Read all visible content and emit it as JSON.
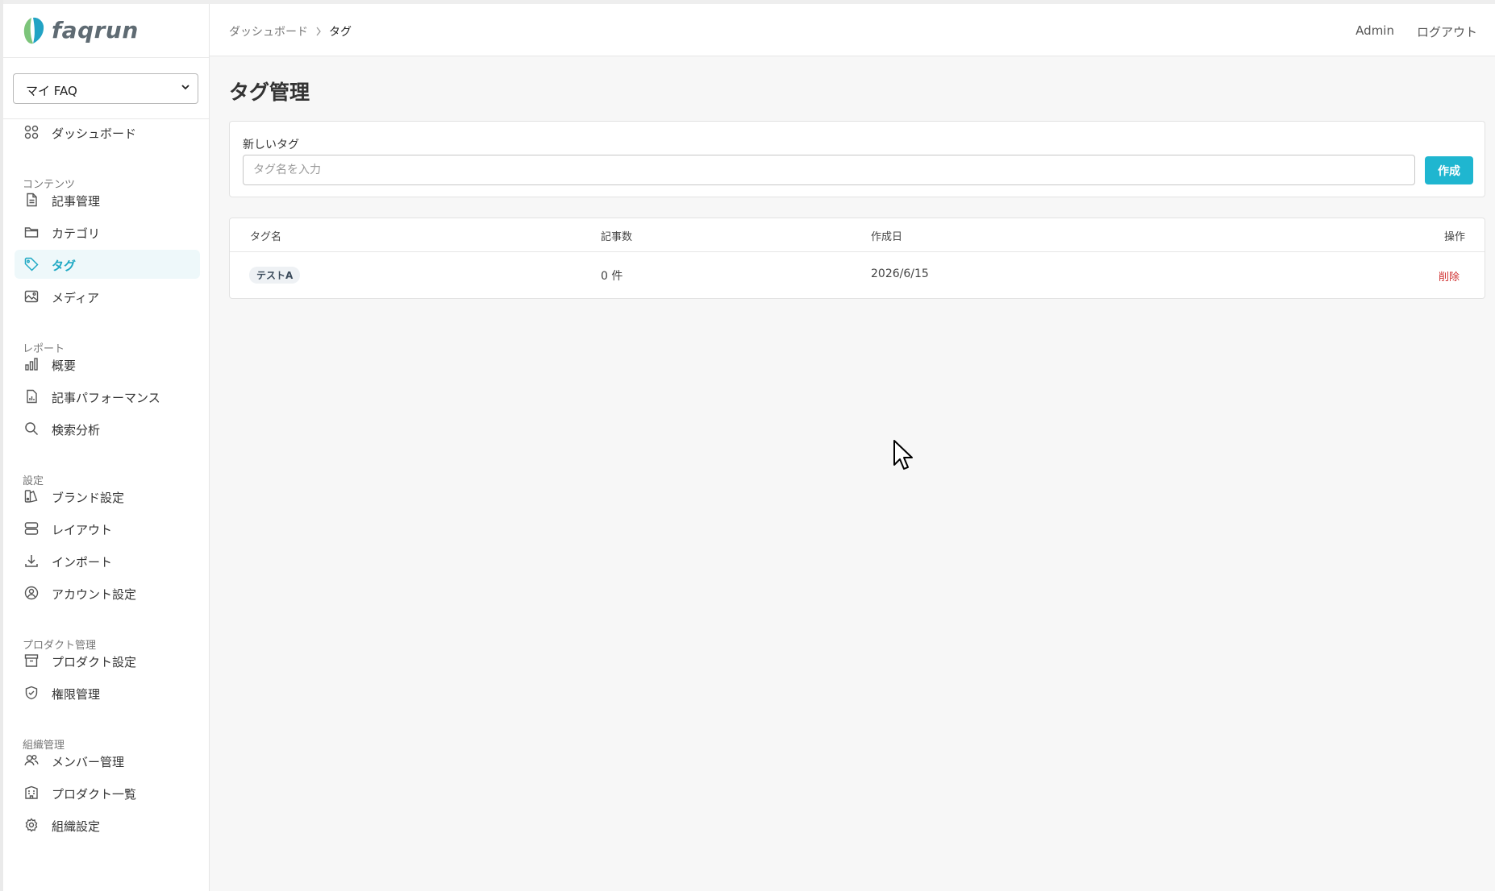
{
  "app": {
    "logo_text": "faqrun"
  },
  "product_selector": {
    "selected": "マイ FAQ"
  },
  "sidebar": {
    "dashboard": {
      "label": "ダッシュボード",
      "icon": "grid-icon"
    },
    "sections": [
      {
        "title": "コンテンツ",
        "items": [
          {
            "label": "記事管理",
            "icon": "document-icon"
          },
          {
            "label": "カテゴリ",
            "icon": "folder-icon"
          },
          {
            "label": "タグ",
            "icon": "tag-icon",
            "active": true
          },
          {
            "label": "メディア",
            "icon": "image-icon"
          }
        ]
      },
      {
        "title": "レポート",
        "items": [
          {
            "label": "概要",
            "icon": "bar-chart-icon"
          },
          {
            "label": "記事パフォーマンス",
            "icon": "document-chart-icon"
          },
          {
            "label": "検索分析",
            "icon": "search-icon"
          }
        ]
      },
      {
        "title": "設定",
        "items": [
          {
            "label": "ブランド設定",
            "icon": "palette-icon"
          },
          {
            "label": "レイアウト",
            "icon": "layout-icon"
          },
          {
            "label": "インポート",
            "icon": "download-icon"
          },
          {
            "label": "アカウント設定",
            "icon": "user-circle-icon"
          }
        ]
      },
      {
        "title": "プロダクト管理",
        "items": [
          {
            "label": "プロダクト設定",
            "icon": "archive-icon"
          },
          {
            "label": "権限管理",
            "icon": "shield-icon"
          }
        ]
      },
      {
        "title": "組織管理",
        "items": [
          {
            "label": "メンバー管理",
            "icon": "users-icon"
          },
          {
            "label": "プロダクト一覧",
            "icon": "building-icon"
          },
          {
            "label": "組織設定",
            "icon": "gear-icon"
          }
        ]
      }
    ]
  },
  "header": {
    "breadcrumb": {
      "parent": "ダッシュボード",
      "current": "タグ"
    },
    "user": "Admin",
    "logout": "ログアウト"
  },
  "page": {
    "title": "タグ管理"
  },
  "new_tag": {
    "label": "新しいタグ",
    "placeholder": "タグ名を入力",
    "value": "",
    "button": "作成"
  },
  "table": {
    "headers": {
      "name": "タグ名",
      "count": "記事数",
      "created": "作成日",
      "actions": "操作"
    },
    "rows": [
      {
        "name": "テストA",
        "count": "0 件",
        "created": "2026/6/15",
        "action": "削除"
      }
    ]
  },
  "colors": {
    "accent": "#1fb6d0",
    "active_bg": "#eef8fa",
    "danger": "#d03030"
  }
}
